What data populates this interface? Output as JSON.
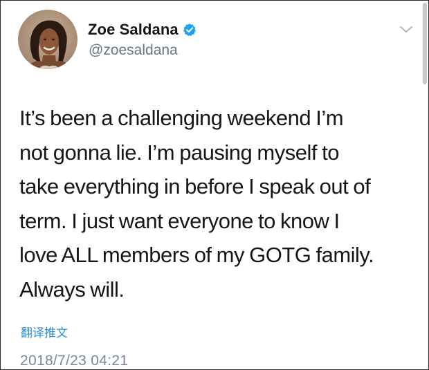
{
  "user": {
    "display_name": "Zoe Saldana",
    "handle": "@zoesaldana",
    "avatar_icon": "profile-photo",
    "verified_icon": "verified-badge-icon",
    "verified_color": "#1da1f2"
  },
  "tweet": {
    "lines": [
      "It’s been a challenging weekend I’m",
      "not gonna lie. I’m pausing myself to",
      "take everything in before I speak out of",
      "term. I just want everyone to know I",
      "love ALL members of my GOTG family.",
      "Always will."
    ],
    "translate_label": "翻译推文",
    "timestamp": "2018/7/23 04:21"
  },
  "menu": {
    "icon": "chevron-down-icon"
  },
  "colors": {
    "text": "#14171a",
    "secondary": "#657786",
    "link": "#2b8fd6"
  }
}
